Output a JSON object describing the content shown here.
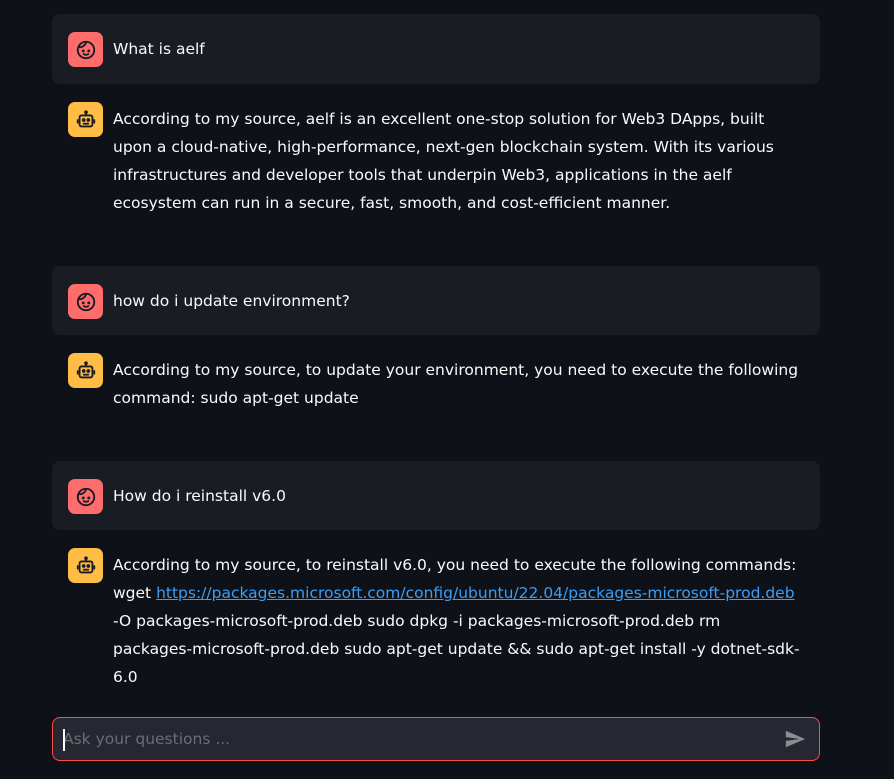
{
  "messages": [
    {
      "role": "user",
      "avatar_icon": "face-icon",
      "text": "What is aelf"
    },
    {
      "role": "assistant",
      "avatar_icon": "robot-icon",
      "text": "According to my source, aelf is an excellent one-stop solution for Web3 DApps, built upon a cloud-native, high-performance, next-gen blockchain system. With its various infrastructures and developer tools that underpin Web3, applications in the aelf ecosystem can run in a secure, fast, smooth, and cost-efficient manner."
    },
    {
      "role": "user",
      "avatar_icon": "face-icon",
      "text": "how do i update environment?"
    },
    {
      "role": "assistant",
      "avatar_icon": "robot-icon",
      "text": "According to my source, to update your environment, you need to execute the following command: sudo apt-get update"
    },
    {
      "role": "user",
      "avatar_icon": "face-icon",
      "text": "How do i reinstall v6.0"
    },
    {
      "role": "assistant",
      "avatar_icon": "robot-icon",
      "text_before": "According to my source, to reinstall v6.0, you need to execute the following commands: wget ",
      "link": "https://packages.microsoft.com/config/ubuntu/22.04/packages-microsoft-prod.deb",
      "text_after": " -O packages-microsoft-prod.deb sudo dpkg -i packages-microsoft-prod.deb rm packages-microsoft-prod.deb sudo apt-get update && sudo apt-get install -y dotnet-sdk-6.0"
    }
  ],
  "chat_input": {
    "placeholder": "Ask your questions ...",
    "value": "",
    "send_icon": "send-icon"
  },
  "colors": {
    "background": "#0e1117",
    "user_message_bg": "#1a1c24",
    "user_avatar": "#ff6c6c",
    "assistant_avatar": "#ffbd45",
    "link": "#3d9df3",
    "input_border": "#ff4b4b"
  }
}
